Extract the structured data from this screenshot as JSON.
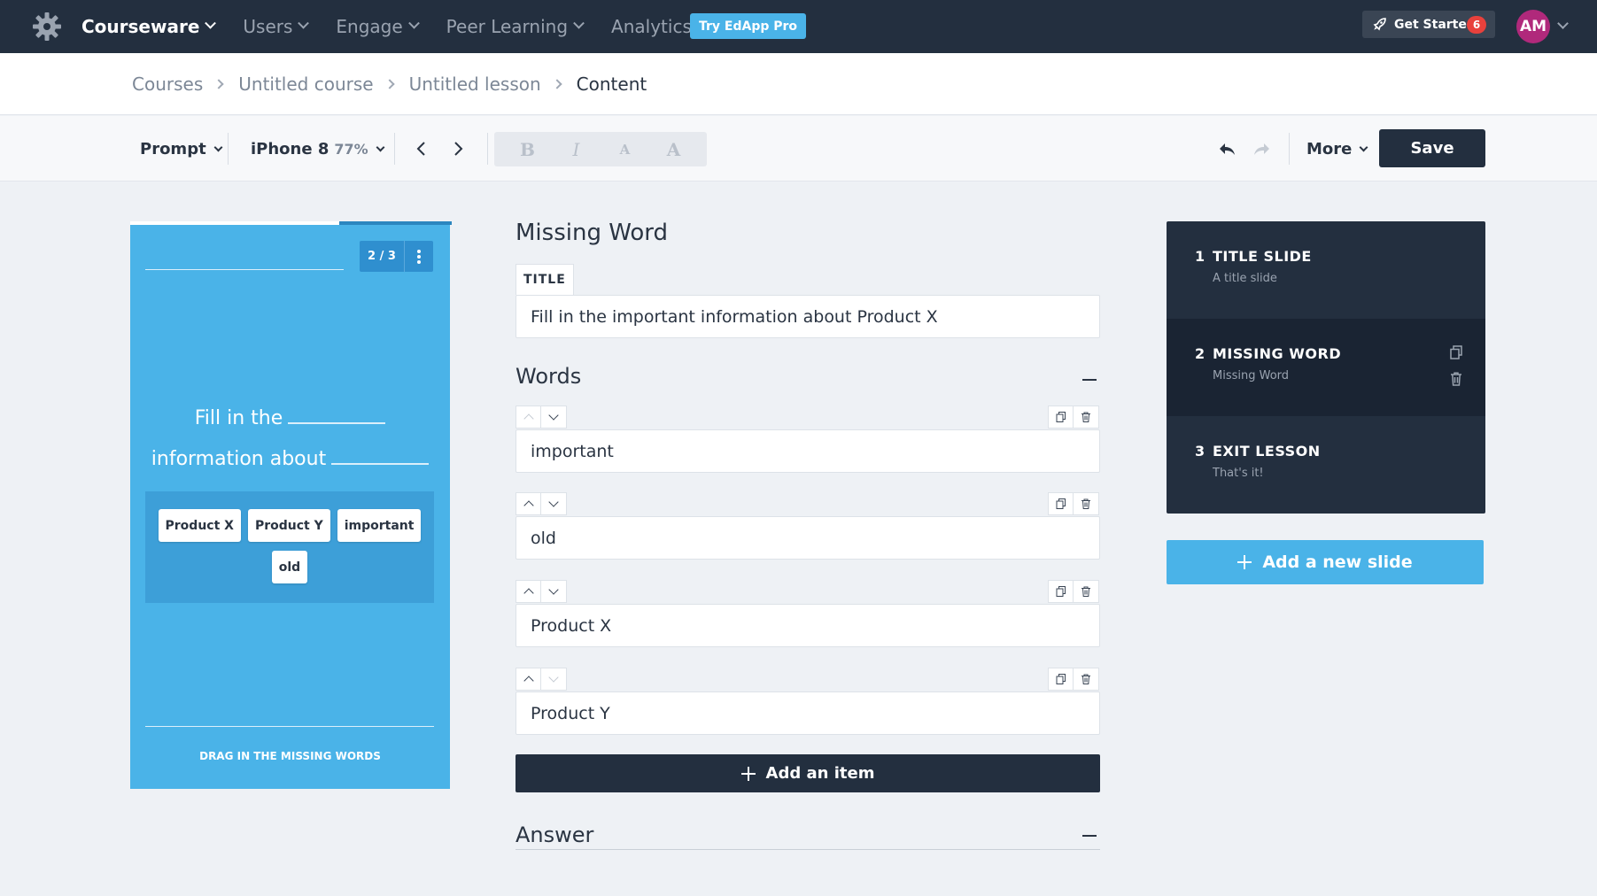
{
  "topnav": {
    "items": [
      {
        "label": "Courseware",
        "active": true
      },
      {
        "label": "Users"
      },
      {
        "label": "Engage"
      },
      {
        "label": "Peer Learning"
      },
      {
        "label": "Analytics"
      }
    ],
    "try_pro": "Try EdApp Pro",
    "get_started": "Get Started",
    "get_started_count": "6",
    "avatar_initials": "AM"
  },
  "breadcrumb": [
    "Courses",
    "Untitled course",
    "Untitled lesson",
    "Content"
  ],
  "toolbar": {
    "template": "Prompt",
    "device": "iPhone 8",
    "zoom": "77%",
    "format_buttons": [
      "B",
      "I",
      "A",
      "A"
    ],
    "more": "More",
    "save": "Save"
  },
  "preview": {
    "counter": "2 / 3",
    "question_line1": "Fill in the",
    "question_line2": "information about",
    "chips": [
      "Product X",
      "Product Y",
      "important",
      "old"
    ],
    "hint": "DRAG IN THE MISSING WORDS",
    "progress": 0.67
  },
  "editor": {
    "heading": "Missing Word",
    "title_label": "TITLE",
    "title_value": "Fill in the important information about Product X",
    "words_heading": "Words",
    "words": [
      "important",
      "old",
      "Product X",
      "Product Y"
    ],
    "add_item": "Add an item",
    "answer_heading": "Answer"
  },
  "slides": [
    {
      "num": "1",
      "title": "TITLE SLIDE",
      "subtitle": "A title slide"
    },
    {
      "num": "2",
      "title": "MISSING WORD",
      "subtitle": "Missing Word",
      "active": true
    },
    {
      "num": "3",
      "title": "EXIT LESSON",
      "subtitle": "That's it!"
    }
  ],
  "add_slide": "Add a new slide",
  "colors": {
    "nav": "#232f3f",
    "accent": "#4ab3e8",
    "badge": "#e8413c",
    "avatar": "#b0297b"
  }
}
